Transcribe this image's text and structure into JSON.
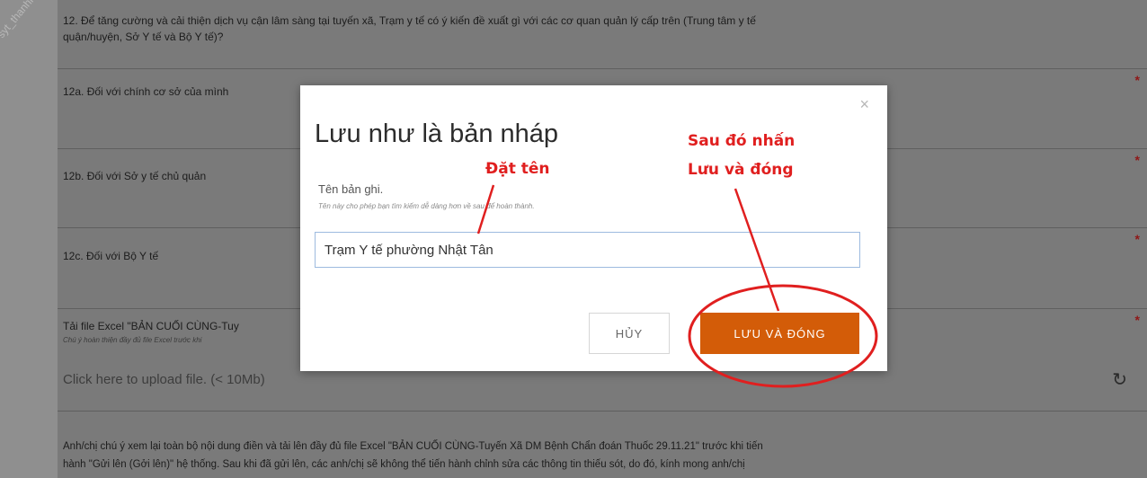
{
  "watermark": "syt_thanhhoa",
  "form": {
    "q12": {
      "line1": "12. Để tăng cường và cải thiện dịch vụ cận lâm sàng tại tuyến xã, Trạm y tế có ý kiến đề xuất gì với các cơ quan quản lý cấp trên (Trung tâm y tế",
      "line2": "quận/huyện, Sở Y tế và Bộ Y tế)?"
    },
    "q12a": "12a. Đối với chính cơ sở của mình",
    "q12b": "12b. Đối với Sở y tế chủ quản",
    "q12c": "12c. Đối với Bộ Y tế",
    "upload": {
      "label": "Tải file Excel \"BẢN CUỐI CÙNG-Tuy",
      "note": "Chú ý hoàn thiện đầy đủ file Excel trước khi",
      "placeholder": "Click here to upload file. (< 10Mb)"
    },
    "bottom": {
      "line1": "Anh/chị chú ý xem lại toàn bộ nội dung điền và tải lên đầy đủ file Excel \"BẢN CUỐI CÙNG-Tuyến Xã DM Bệnh Chẩn đoán Thuốc 29.11.21\" trước khi tiến",
      "line2": "hành \"Gửi lên (Gởi lên)\" hệ thống. Sau khi đã gửi lên, các anh/chị sẽ không thể tiến hành chỉnh sửa các thông tin thiếu sót, do đó, kính mong anh/chị"
    },
    "required_mark": "*"
  },
  "modal": {
    "title": "Lưu như là bản nháp",
    "close_icon": "×",
    "field_label": "Tên bản ghi.",
    "field_help": "Tên này cho phép bạn tìm kiếm dễ dàng hơn về sau để hoàn thành.",
    "field_value": "Trạm Y tế phường Nhật Tân",
    "cancel_label": "HỦY",
    "save_label": "LƯU VÀ ĐÓNG"
  },
  "annotations": {
    "name_hint": "Đặt tên",
    "save_hint_line1": "Sau đó nhấn",
    "save_hint_line2": "Lưu và đóng",
    "color": "#e01f1f"
  },
  "colors": {
    "overlay": "#7a7a7a",
    "save_button": "#d35c08",
    "required": "#8f1717"
  }
}
